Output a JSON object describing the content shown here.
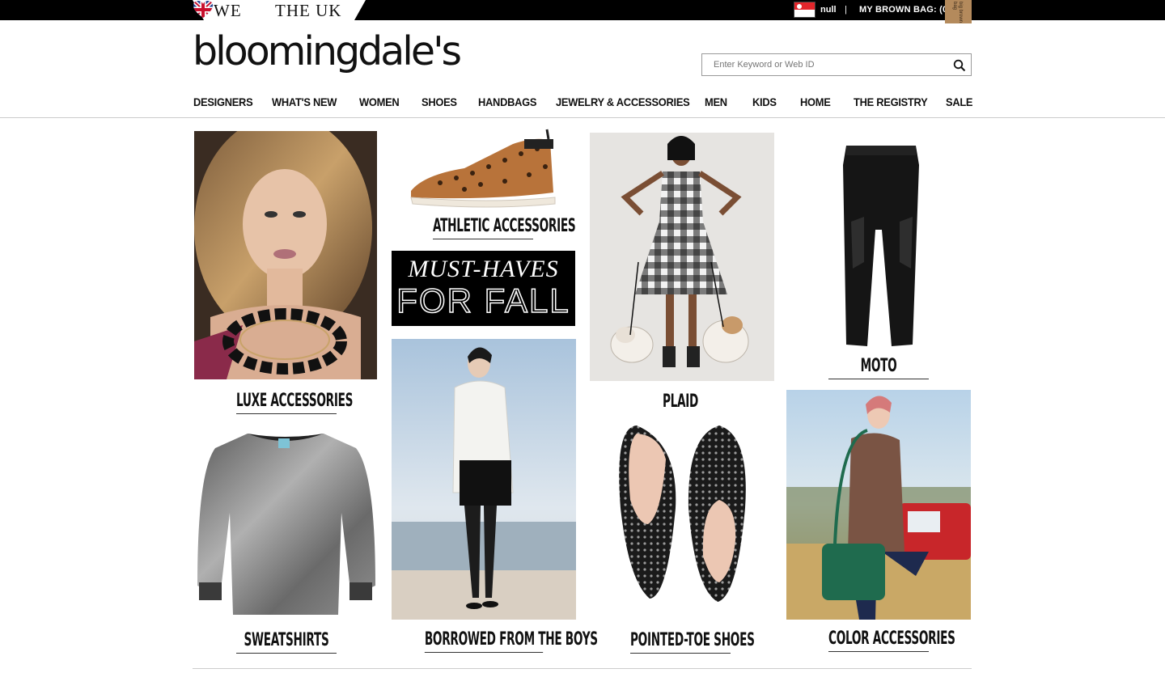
{
  "topbar": {
    "promo_we": "WE",
    "promo_uk": "THE UK",
    "country": "null",
    "separator": "|",
    "bag_label": "MY BROWN BAG: (0)",
    "bag_icon_text": "big brown bag"
  },
  "header": {
    "logo": "bloomingdale's",
    "search_placeholder": "Enter Keyword or Web ID"
  },
  "nav": {
    "items": [
      "DESIGNERS",
      "WHAT'S NEW",
      "WOMEN",
      "SHOES",
      "HANDBAGS",
      "JEWELRY & ACCESSORIES",
      "MEN",
      "KIDS",
      "HOME",
      "THE REGISTRY",
      "SALE"
    ]
  },
  "tiles": {
    "luxe": "LUXE ACCESSORIES",
    "athletic": "ATHLETIC ACCESSORIES",
    "musthaves_line1": "MUST-HAVES",
    "musthaves_line2": "FOR FALL",
    "plaid": "PLAID",
    "moto": "MOTO",
    "sweatshirts": "SWEATSHIRTS",
    "borrowed": "BORROWED FROM THE BOYS",
    "pointed": "POINTED-TOE SHOES",
    "color": "COLOR ACCESSORIES"
  },
  "colors": {
    "topbar": "#000000",
    "text": "#111111",
    "divider": "#cccccc"
  }
}
